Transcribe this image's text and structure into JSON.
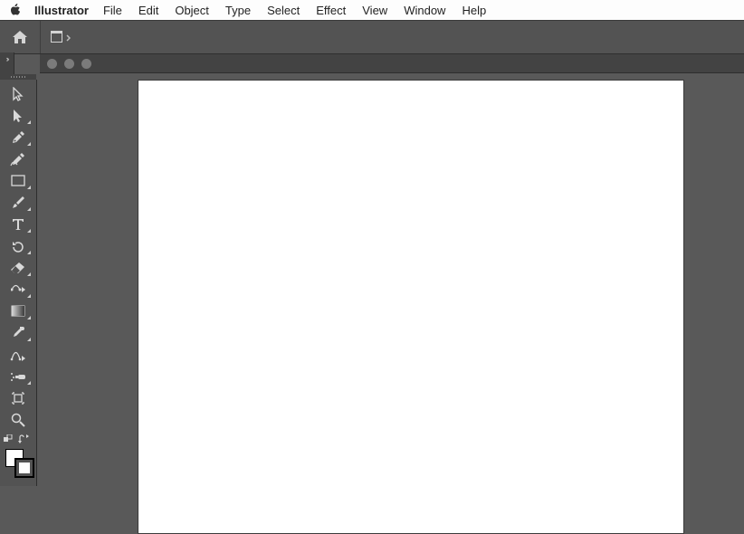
{
  "menubar": {
    "app_name": "Illustrator",
    "items": [
      "File",
      "Edit",
      "Object",
      "Type",
      "Select",
      "Effect",
      "View",
      "Window",
      "Help"
    ]
  },
  "topbar": {
    "home_label": "Home",
    "workspace_label": "Arrange Documents"
  },
  "toolbar": {
    "tools": [
      "selection",
      "direct-selection",
      "pen",
      "curvature",
      "rectangle",
      "paintbrush",
      "type",
      "rotate",
      "eraser",
      "free-transform",
      "gradient",
      "eyedropper",
      "blend",
      "symbol-sprayer",
      "artboard",
      "zoom"
    ],
    "swap_icons": [
      "swap-fill-stroke",
      "default-fill-stroke"
    ],
    "fill_color": "#ffffff",
    "stroke_color": "#000000"
  },
  "document": {
    "traffic": [
      "close",
      "minimize",
      "maximize"
    ]
  }
}
